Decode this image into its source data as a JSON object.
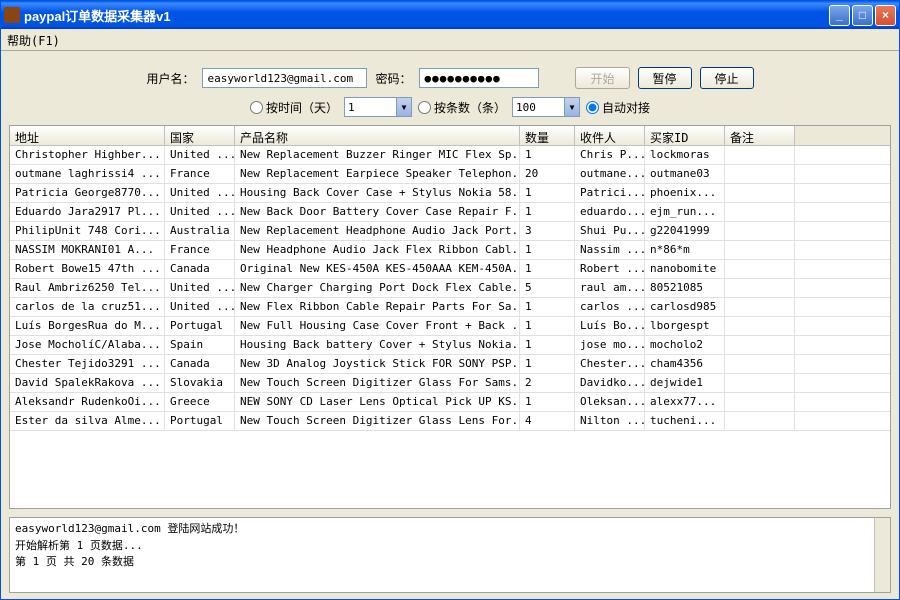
{
  "window": {
    "title": "paypal订单数据采集器v1"
  },
  "menu": {
    "help": "帮助(F1)"
  },
  "form": {
    "user_label": "用户名：",
    "user_value": "easyworld123@gmail.com",
    "pass_label": "密码：",
    "pass_value": "●●●●●●●●●●",
    "btn_start": "开始",
    "btn_pause": "暂停",
    "btn_stop": "停止"
  },
  "filter": {
    "by_time_label": "按时间（天）",
    "time_value": "1",
    "by_count_label": "按条数（条）",
    "count_value": "100",
    "auto_label": "自动对接"
  },
  "table": {
    "headers": [
      "地址",
      "国家",
      "产品名称",
      "数量",
      "收件人",
      "买家ID",
      "备注"
    ],
    "rows": [
      [
        "Christopher Highber...",
        "United ...",
        "New Replacement Buzzer Ringer MIC Flex Sp...",
        "1",
        "Chris P...",
        "lockmoras",
        ""
      ],
      [
        "outmane laghrissi4 ...",
        "France",
        "New Replacement Earpiece Speaker Telephon...",
        "20",
        "outmane...",
        "outmane03",
        ""
      ],
      [
        "Patricia George8770...",
        "United ...",
        "Housing Back Cover Case + Stylus Nokia 58...",
        "1",
        "Patrici...",
        "phoenix...",
        ""
      ],
      [
        "Eduardo Jara2917 Pl...",
        "United ...",
        "New Back Door Battery Cover Case Repair F...",
        "1",
        "eduardo...",
        "ejm_run...",
        ""
      ],
      [
        "PhilipUnit 748 Cori...",
        "Australia",
        "New Replacement Headphone Audio Jack Port...",
        "3",
        "Shui Pu...",
        "g22041999",
        ""
      ],
      [
        "NASSIM  MOKRANI01 A...",
        "France",
        "New Headphone Audio Jack Flex Ribbon Cabl...",
        "1",
        "Nassim ...",
        "n*86*m",
        ""
      ],
      [
        "Robert Bowe15 47th ...",
        "Canada",
        "Original New KES-450A KES-450AAA KEM-450A...",
        "1",
        "Robert ...",
        "nanobomite",
        ""
      ],
      [
        "Raul Ambriz6250 Tel...",
        "United ...",
        "New Charger Charging Port Dock Flex Cable...",
        "5",
        "raul am...",
        "80521085",
        ""
      ],
      [
        "carlos de la cruz51...",
        "United ...",
        "New Flex Ribbon Cable Repair Parts For Sa...",
        "1",
        "carlos ...",
        "carlosd985",
        ""
      ],
      [
        "Luís BorgesRua do M...",
        "Portugal",
        "New Full Housing Case Cover Front + Back ...",
        "1",
        "Luís Bo...",
        "lborgespt",
        ""
      ],
      [
        "Jose MocholíC/Alaba...",
        "Spain",
        "Housing Back battery Cover + Stylus Nokia...",
        "1",
        "jose mo...",
        "mocholo2",
        ""
      ],
      [
        "Chester Tejido3291 ...",
        "Canada",
        "New 3D Analog Joystick Stick FOR SONY PSP...",
        "1",
        "Chester...",
        "cham4356",
        ""
      ],
      [
        "David SpalekRakova ...",
        "Slovakia",
        "New Touch Screen Digitizer Glass For Sams...",
        "2",
        "Davidko...",
        "dejwide1",
        ""
      ],
      [
        "Aleksandr RudenkoOi...",
        "Greece",
        "NEW SONY CD Laser Lens Optical Pick UP KS...",
        "1",
        "Oleksan...",
        "alexx77...",
        ""
      ],
      [
        "Ester da silva Alme...",
        "Portugal",
        "New Touch Screen Digitizer Glass Lens For...",
        "4",
        "Nilton ...",
        "tucheni...",
        ""
      ]
    ]
  },
  "log": {
    "line1": "easyworld123@gmail.com 登陆网站成功！",
    "line2": "开始解析第  1 页数据...",
    "line3": "第  1 页 共 20 条数据"
  }
}
